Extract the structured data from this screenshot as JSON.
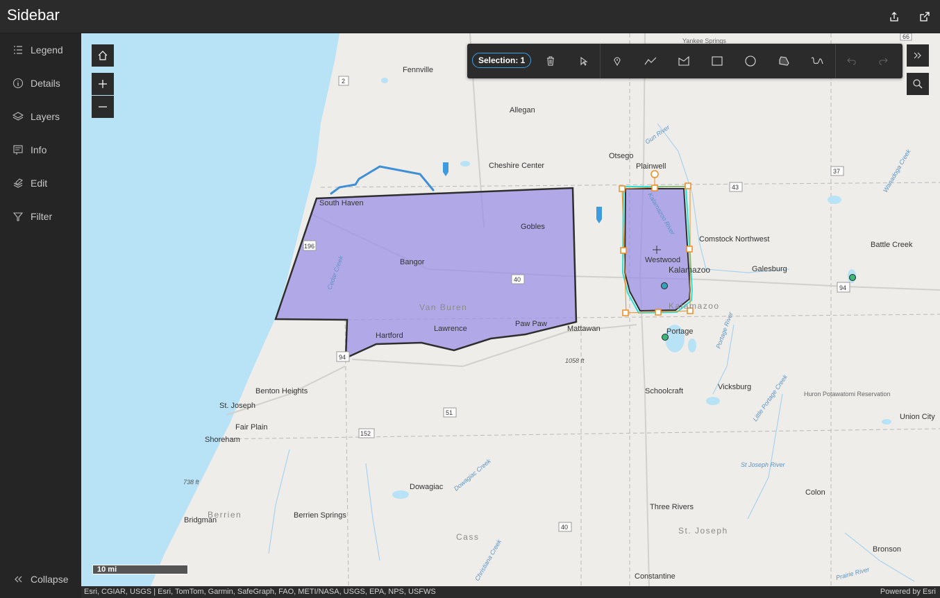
{
  "header": {
    "title": "Sidebar",
    "share_icon": "share-icon",
    "export_icon": "open-external-icon"
  },
  "sidebar": {
    "items": [
      {
        "label": "Legend",
        "icon": "legend-icon"
      },
      {
        "label": "Details",
        "icon": "info-circle-icon"
      },
      {
        "label": "Layers",
        "icon": "layers-icon"
      },
      {
        "label": "Info",
        "icon": "popup-icon"
      },
      {
        "label": "Edit",
        "icon": "edit-icon"
      },
      {
        "label": "Filter",
        "icon": "filter-icon"
      }
    ],
    "collapse": {
      "label": "Collapse",
      "icon": "chevrons-left-icon"
    }
  },
  "toolbar": {
    "selection_label": "Selection: 1",
    "tools": [
      "trash-icon",
      "select-cursor-icon",
      "point-icon",
      "polyline-icon",
      "polygon-icon",
      "rectangle-icon",
      "circle-icon",
      "freehand-polygon-icon",
      "freehand-line-icon",
      "undo-icon",
      "redo-icon"
    ],
    "expand_icon": "chevrons-right-icon"
  },
  "map": {
    "cities": [
      "Fennville",
      "Allegan",
      "Cheshire Center",
      "Otsego",
      "Plainwell",
      "South Haven",
      "Gobles",
      "Comstock Northwest",
      "Battle Creek",
      "Bangor",
      "Westwood",
      "Kalamazoo",
      "Galesburg",
      "Hartford",
      "Lawrence",
      "Paw Paw",
      "Mattawan",
      "Portage",
      "Benton Heights",
      "St. Joseph",
      "Fair Plain",
      "Shoreham",
      "Schoolcraft",
      "Vicksburg",
      "Huron Potawatomi Reservation",
      "Union City",
      "Dowagiac",
      "Colon",
      "Bridgman",
      "Berrien Springs",
      "Three Rivers",
      "Bronson",
      "Constantine",
      "Yankee Springs"
    ],
    "counties": [
      "Van Buren",
      "Kalamazoo",
      "Berrien",
      "Cass",
      "St. Joseph"
    ],
    "water_labels": [
      "Gun River",
      "Kalamazoo River",
      "Wanadoga Creek",
      "Cedar Creek",
      "Portage River",
      "Little Portage Creek",
      "St Joseph River",
      "Dowagiac Creek",
      "Prairie River",
      "Christiana Creek"
    ],
    "elevations": [
      "1058 ft",
      "738 ft"
    ],
    "shields": [
      "66",
      "2",
      "37",
      "43",
      "196",
      "40",
      "94",
      "51",
      "152",
      "40",
      "94"
    ]
  },
  "scale": {
    "label": "10 mi"
  },
  "attribution": {
    "left": "Esri, CGIAR, USGS | Esri, TomTom, Garmin, SafeGraph, FAO, METI/NASA, USGS, EPA, NPS, USFWS",
    "right": "Powered by Esri"
  },
  "colors": {
    "accent": "#3aa0e8",
    "polygon_fill": "#9a8ee6",
    "selection_outline": "#2ee0d8",
    "handles": "#f08c1e",
    "lake": "#b8e2f5"
  }
}
